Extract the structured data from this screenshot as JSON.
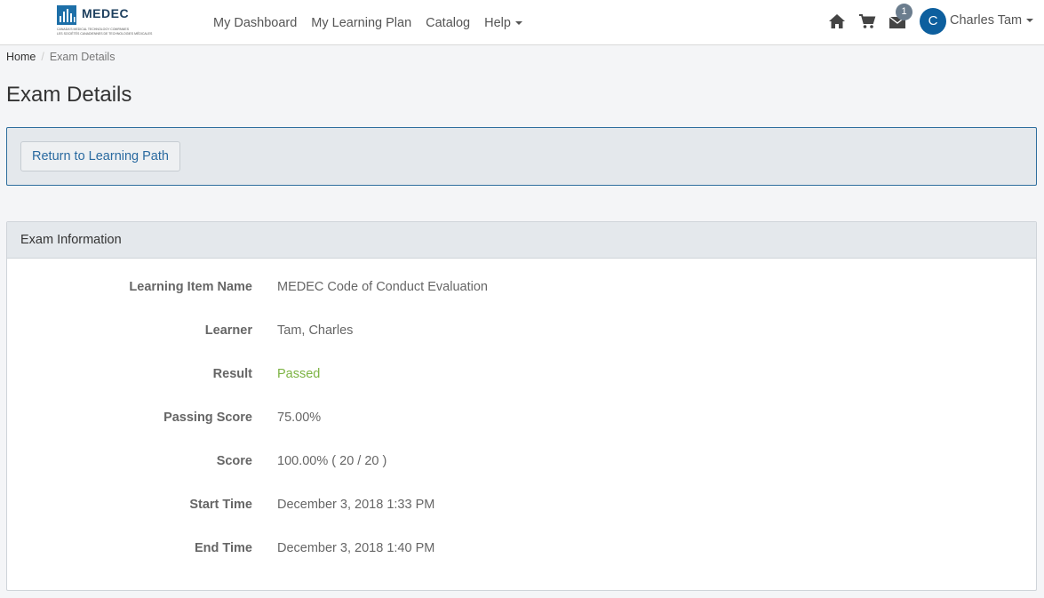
{
  "header": {
    "logo": {
      "name": "MEDEC",
      "subtitle_en": "CANADA'S MEDICAL TECHNOLOGY COMPANIES",
      "subtitle_fr": "LES SOCIÉTÉS CANADIENNES DE TECHNOLOGIES MÉDICALES"
    },
    "nav": [
      {
        "label": "My Dashboard"
      },
      {
        "label": "My Learning Plan"
      },
      {
        "label": "Catalog"
      },
      {
        "label": "Help",
        "has_dropdown": true
      }
    ],
    "icons": [
      "home-icon",
      "cart-icon",
      "envelope-icon"
    ],
    "messages_badge": "1",
    "user": {
      "initial": "C",
      "name": "Charles Tam"
    }
  },
  "breadcrumb": {
    "home": "Home",
    "separator": "/",
    "current": "Exam Details"
  },
  "page_title": "Exam Details",
  "actions": {
    "return_label": "Return to Learning Path"
  },
  "panel": {
    "heading": "Exam Information",
    "rows": [
      {
        "label": "Learning Item Name",
        "value": "MEDEC Code of Conduct Evaluation"
      },
      {
        "label": "Learner",
        "value": "Tam, Charles"
      },
      {
        "label": "Result",
        "value": "Passed"
      },
      {
        "label": "Passing Score",
        "value": "75.00%"
      },
      {
        "label": "Score",
        "value": "100.00% ( 20 / 20 )"
      },
      {
        "label": "Start Time",
        "value": "December 3, 2018 1:33 PM"
      },
      {
        "label": "End Time",
        "value": "December 3, 2018 1:40 PM"
      }
    ]
  },
  "colors": {
    "brand": "#0d5f9e",
    "link": "#2a6aa0",
    "passed": "#7cb342",
    "badge": "#6b7d8e"
  }
}
